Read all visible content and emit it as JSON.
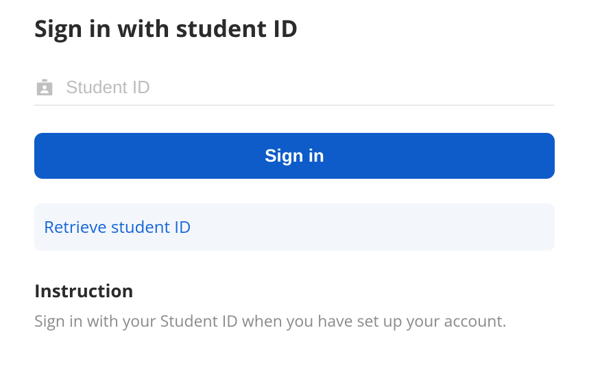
{
  "heading": "Sign in with student ID",
  "input": {
    "placeholder": "Student ID",
    "value": ""
  },
  "signin_button": "Sign in",
  "retrieve_link": "Retrieve student ID",
  "instruction": {
    "title": "Instruction",
    "body": "Sign in with your Student ID when you have set up your account."
  }
}
